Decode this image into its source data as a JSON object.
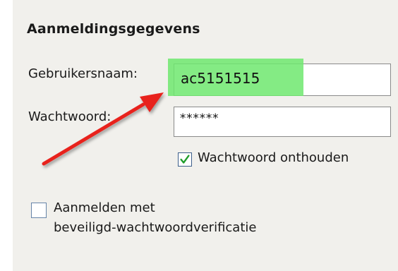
{
  "section": {
    "title": "Aanmeldingsgegevens"
  },
  "username": {
    "label": "Gebruikersnaam:",
    "value": "ac5151515"
  },
  "password": {
    "label": "Wachtwoord:",
    "value": "******"
  },
  "remember_password": {
    "label": "Wachtwoord onthouden",
    "checked": true
  },
  "spa": {
    "label_line1": "Aanmelden met",
    "label_line2": "beveiligd-wachtwoordverificatie",
    "checked": false
  },
  "annotations": {
    "highlight_color": "#6fe86f",
    "arrow_color": "#e8201c"
  }
}
